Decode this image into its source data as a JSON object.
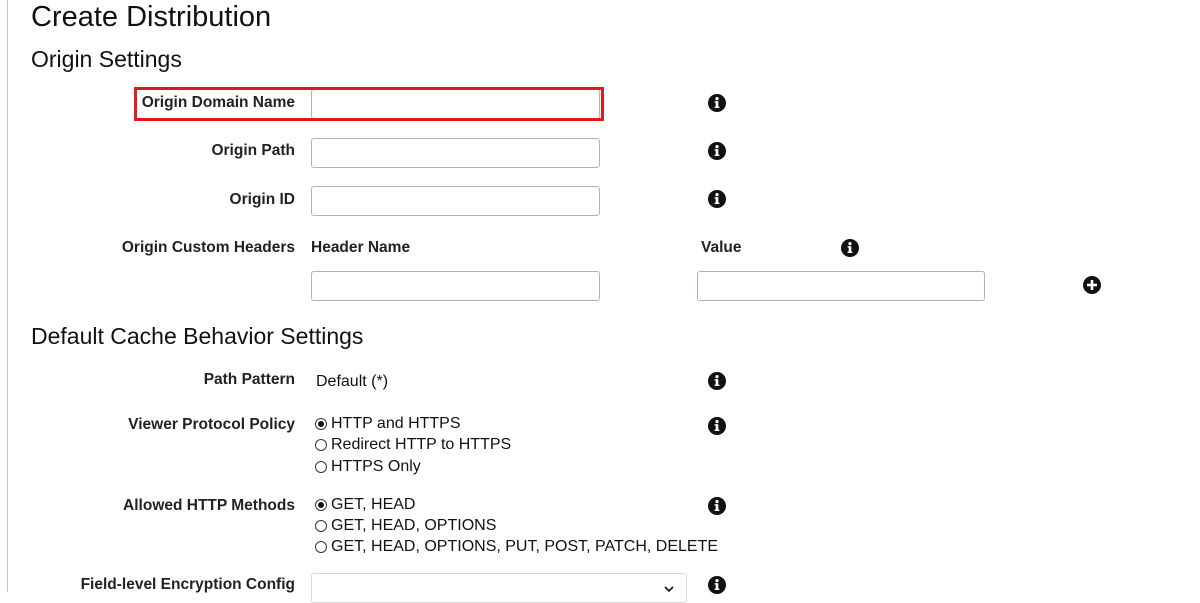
{
  "page": {
    "title": "Create Distribution"
  },
  "colors": {
    "highlight": "#dd1c1c",
    "border": "#aab7b8",
    "text": "#111111",
    "icon": "#111111"
  },
  "origin_settings": {
    "heading": "Origin Settings",
    "origin_domain_name": {
      "label": "Origin Domain Name",
      "value": "",
      "placeholder": ""
    },
    "origin_path": {
      "label": "Origin Path",
      "value": "",
      "placeholder": ""
    },
    "origin_id": {
      "label": "Origin ID",
      "value": "",
      "placeholder": ""
    },
    "origin_custom_headers": {
      "label": "Origin Custom Headers",
      "header_name_col": "Header Name",
      "value_col": "Value",
      "header_name_value": "",
      "value_value": "",
      "add_icon": "plus-circle-icon"
    }
  },
  "default_cache_behavior": {
    "heading": "Default Cache Behavior Settings",
    "path_pattern": {
      "label": "Path Pattern",
      "value": "Default (*)"
    },
    "viewer_protocol_policy": {
      "label": "Viewer Protocol Policy",
      "options": [
        "HTTP and HTTPS",
        "Redirect HTTP to HTTPS",
        "HTTPS Only"
      ],
      "selected": "HTTP and HTTPS"
    },
    "allowed_http_methods": {
      "label": "Allowed HTTP Methods",
      "options": [
        "GET, HEAD",
        "GET, HEAD, OPTIONS",
        "GET, HEAD, OPTIONS, PUT, POST, PATCH, DELETE"
      ],
      "selected": "GET, HEAD"
    },
    "field_level_encryption": {
      "label": "Field-level Encryption Config",
      "value": ""
    }
  },
  "icons": {
    "info": "info-icon",
    "dropdown": "chevron-down-icon"
  }
}
